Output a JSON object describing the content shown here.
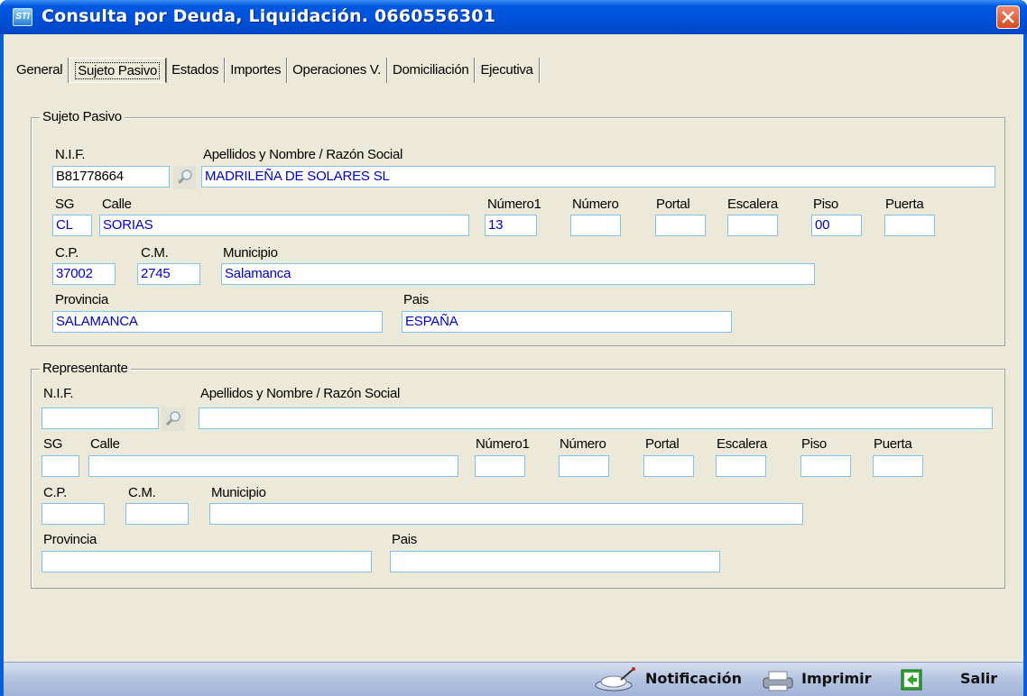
{
  "window": {
    "title": "Consulta por Deuda, Liquidación. 0660556301",
    "app_icon_text": "STI"
  },
  "tabs": [
    {
      "label": "General",
      "active": false
    },
    {
      "label": "Sujeto Pasivo",
      "active": true
    },
    {
      "label": "Estados",
      "active": false
    },
    {
      "label": "Importes",
      "active": false
    },
    {
      "label": "Operaciones V.",
      "active": false
    },
    {
      "label": "Domiciliación",
      "active": false
    },
    {
      "label": "Ejecutiva",
      "active": false
    }
  ],
  "sujeto": {
    "legend": "Sujeto Pasivo",
    "labels": {
      "nif": "N.I.F.",
      "nombre": "Apellidos y Nombre / Razón Social",
      "sg": "SG",
      "calle": "Calle",
      "numero1": "Número1",
      "numero": "Número",
      "portal": "Portal",
      "escalera": "Escalera",
      "piso": "Piso",
      "puerta": "Puerta",
      "cp": "C.P.",
      "cm": "C.M.",
      "municipio": "Municipio",
      "provincia": "Provincia",
      "pais": "Pais"
    },
    "values": {
      "nif": "B81778664",
      "nombre": "MADRILEÑA DE SOLARES SL",
      "sg": "CL",
      "calle": "SORIAS",
      "numero1": "13",
      "numero": "",
      "portal": "",
      "escalera": "",
      "piso": "00",
      "puerta": "",
      "cp": "37002",
      "cm": "2745",
      "municipio": "Salamanca",
      "provincia": "SALAMANCA",
      "pais": "ESPAÑA"
    }
  },
  "representante": {
    "legend": "Representante",
    "labels": {
      "nif": "N.I.F.",
      "nombre": "Apellidos y Nombre / Razón Social",
      "sg": "SG",
      "calle": "Calle",
      "numero1": "Número1",
      "numero": "Número",
      "portal": "Portal",
      "escalera": "Escalera",
      "piso": "Piso",
      "puerta": "Puerta",
      "cp": "C.P.",
      "cm": "C.M.",
      "municipio": "Municipio",
      "provincia": "Provincia",
      "pais": "Pais"
    },
    "values": {
      "nif": "",
      "nombre": "",
      "sg": "",
      "calle": "",
      "numero1": "",
      "numero": "",
      "portal": "",
      "escalera": "",
      "piso": "",
      "puerta": "",
      "cp": "",
      "cm": "",
      "municipio": "",
      "provincia": "",
      "pais": ""
    }
  },
  "statusbar": {
    "notificacion": "Notificación",
    "imprimir": "Imprimir",
    "salir": "Salir"
  },
  "colors": {
    "field_text": "#0000d0",
    "field_border": "#7fc2ee",
    "client_bg": "#ece9d8",
    "titlebar": "#0050d8"
  }
}
